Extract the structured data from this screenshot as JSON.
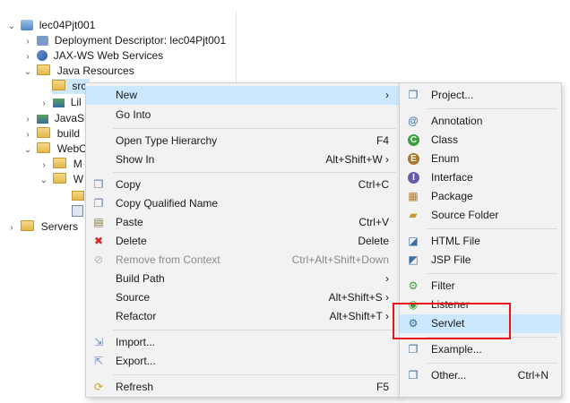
{
  "explorer": {
    "nodes": [
      {
        "label": "lec04Pjt001",
        "twisty": "⌄"
      },
      {
        "label": "Deployment Descriptor: lec04Pjt001",
        "twisty": "›"
      },
      {
        "label": "JAX-WS Web Services",
        "twisty": "›"
      },
      {
        "label": "Java Resources",
        "twisty": "⌄"
      },
      {
        "label": "src",
        "twisty": ""
      },
      {
        "label": "Lil",
        "twisty": "›"
      },
      {
        "label": "JavaS",
        "twisty": "›"
      },
      {
        "label": "build",
        "twisty": "›"
      },
      {
        "label": "WebC",
        "twisty": "⌄"
      },
      {
        "label": "M",
        "twisty": "›"
      },
      {
        "label": "W",
        "twisty": "⌄"
      },
      {
        "label": "Servers",
        "twisty": "›"
      }
    ]
  },
  "context_menu": {
    "items": [
      {
        "label": "New",
        "accel": "›",
        "icon": "",
        "selected": true
      },
      {
        "label": "Go Into",
        "accel": "",
        "icon": ""
      },
      {
        "label": "Open Type Hierarchy",
        "accel": "F4",
        "icon": ""
      },
      {
        "label": "Show In",
        "accel": "Alt+Shift+W ›",
        "icon": ""
      },
      {
        "label": "Copy",
        "accel": "Ctrl+C",
        "icon": "copy-icon"
      },
      {
        "label": "Copy Qualified Name",
        "accel": "",
        "icon": "copy-qualified-icon"
      },
      {
        "label": "Paste",
        "accel": "Ctrl+V",
        "icon": "paste-icon"
      },
      {
        "label": "Delete",
        "accel": "Delete",
        "icon": "delete-icon"
      },
      {
        "label": "Remove from Context",
        "accel": "Ctrl+Alt+Shift+Down",
        "icon": "remove-context-icon",
        "disabled": true
      },
      {
        "label": "Build Path",
        "accel": "›",
        "icon": ""
      },
      {
        "label": "Source",
        "accel": "Alt+Shift+S ›",
        "icon": ""
      },
      {
        "label": "Refactor",
        "accel": "Alt+Shift+T ›",
        "icon": ""
      },
      {
        "label": "Import...",
        "accel": "",
        "icon": "import-icon"
      },
      {
        "label": "Export...",
        "accel": "",
        "icon": "export-icon"
      },
      {
        "label": "Refresh",
        "accel": "F5",
        "icon": "refresh-icon"
      }
    ]
  },
  "submenu": {
    "items": [
      {
        "label": "Project...",
        "accel": "",
        "icon": "project-icon"
      },
      {
        "label": "Annotation",
        "accel": "",
        "icon": "annotation-icon"
      },
      {
        "label": "Class",
        "accel": "",
        "icon": "class-icon"
      },
      {
        "label": "Enum",
        "accel": "",
        "icon": "enum-icon"
      },
      {
        "label": "Interface",
        "accel": "",
        "icon": "interface-icon"
      },
      {
        "label": "Package",
        "accel": "",
        "icon": "package-icon"
      },
      {
        "label": "Source Folder",
        "accel": "",
        "icon": "source-folder-icon"
      },
      {
        "label": "HTML File",
        "accel": "",
        "icon": "html-file-icon"
      },
      {
        "label": "JSP File",
        "accel": "",
        "icon": "jsp-file-icon"
      },
      {
        "label": "Filter",
        "accel": "",
        "icon": "filter-icon"
      },
      {
        "label": "Listener",
        "accel": "",
        "icon": "listener-icon"
      },
      {
        "label": "Servlet",
        "accel": "",
        "icon": "servlet-icon",
        "selected": true
      },
      {
        "label": "Example...",
        "accel": "",
        "icon": "example-icon"
      },
      {
        "label": "Other...",
        "accel": "Ctrl+N",
        "icon": "other-icon"
      }
    ]
  },
  "colors": {
    "selection": "#cce8ff",
    "highlight_box": "#e8141c",
    "menu_bg": "#f2f2f2"
  }
}
